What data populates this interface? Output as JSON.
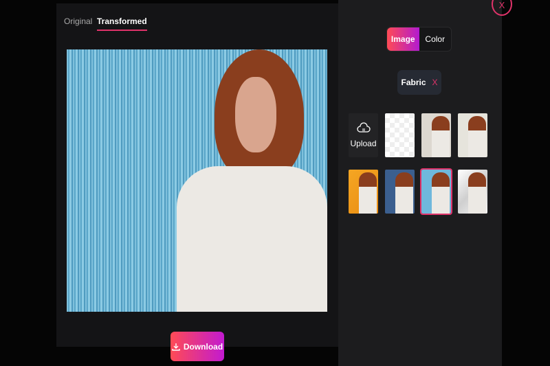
{
  "tabs": [
    {
      "label": "Original",
      "active": false
    },
    {
      "label": "Transformed",
      "active": true
    }
  ],
  "download_label": "Download",
  "close_label": "X",
  "mode_toggle": [
    {
      "label": "Image",
      "active": true
    },
    {
      "label": "Color",
      "active": false
    }
  ],
  "filter_chip": {
    "label": "Fabric",
    "remove": "X"
  },
  "upload_label": "Upload",
  "backgrounds": [
    {
      "name": "transparent"
    },
    {
      "name": "light-gray"
    },
    {
      "name": "textured-white"
    },
    {
      "name": "orange"
    },
    {
      "name": "denim"
    },
    {
      "name": "blue-fabric",
      "selected": true
    },
    {
      "name": "white-fabric"
    }
  ],
  "colors": {
    "accent": "#e0336a",
    "gradient_start": "#ff4b55",
    "gradient_end": "#c21ad0"
  }
}
